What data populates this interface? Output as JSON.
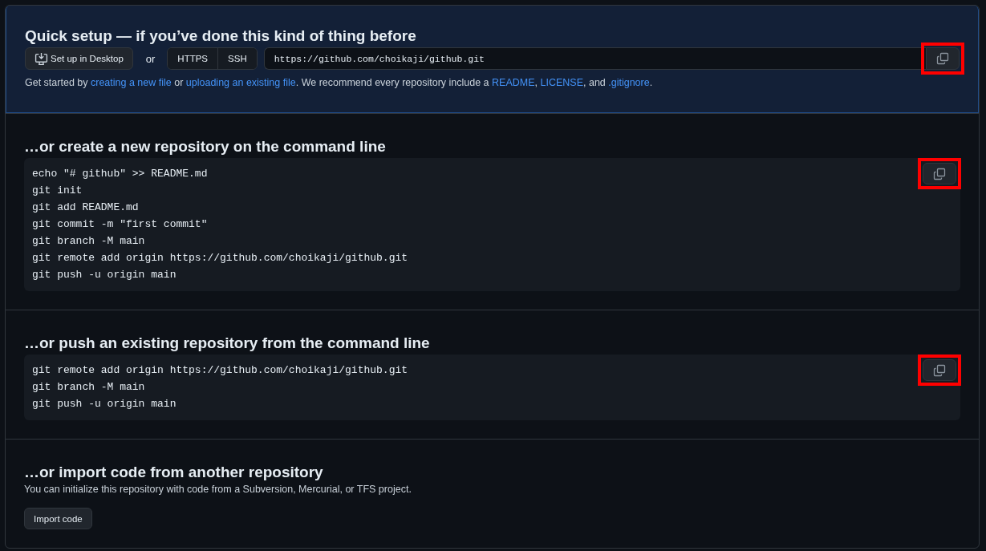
{
  "quick_setup": {
    "title": "Quick setup — if you’ve done this kind of thing before",
    "desktop_button": "Set up in Desktop",
    "or_text": "or",
    "protocols": [
      {
        "label": "HTTPS"
      },
      {
        "label": "SSH"
      }
    ],
    "clone_url": "https://github.com/choikaji/github.git",
    "copy_highlighted": true,
    "hint": [
      {
        "kind": "text",
        "text": "Get started by "
      },
      {
        "kind": "link",
        "text": "creating a new file"
      },
      {
        "kind": "text",
        "text": " or "
      },
      {
        "kind": "link",
        "text": "uploading an existing file"
      },
      {
        "kind": "text",
        "text": ". We recommend every repository include a "
      },
      {
        "kind": "link",
        "text": "README"
      },
      {
        "kind": "text",
        "text": ", "
      },
      {
        "kind": "link",
        "text": "LICENSE"
      },
      {
        "kind": "text",
        "text": ", and "
      },
      {
        "kind": "link",
        "text": ".gitignore"
      },
      {
        "kind": "text",
        "text": "."
      }
    ]
  },
  "code_sections": [
    {
      "title": "…or create a new repository on the command line",
      "copy_highlighted": true,
      "lines": [
        "echo \"# github\" >> README.md",
        "git init",
        "git add README.md",
        "git commit -m \"first commit\"",
        "git branch -M main",
        "git remote add origin https://github.com/choikaji/github.git",
        "git push -u origin main"
      ]
    },
    {
      "title": "…or push an existing repository from the command line",
      "copy_highlighted": true,
      "lines": [
        "git remote add origin https://github.com/choikaji/github.git",
        "git branch -M main",
        "git push -u origin main"
      ]
    }
  ],
  "import_section": {
    "title": "…or import code from another repository",
    "description": "You can initialize this repository with code from a Subversion, Mercurial, or TFS project.",
    "button": "Import code"
  }
}
